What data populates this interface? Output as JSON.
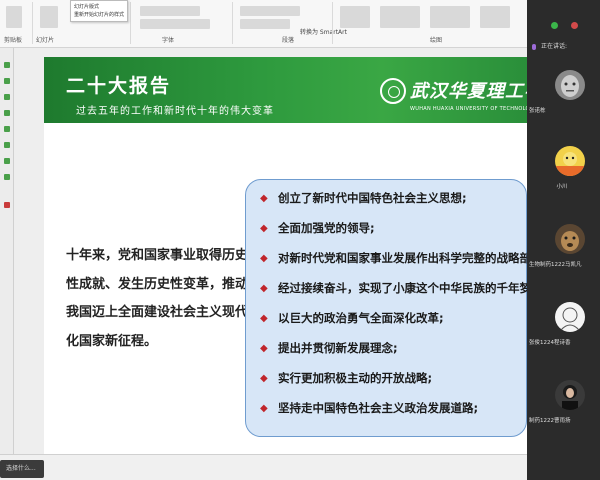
{
  "ribbon": {
    "groups": [
      "剪贴板",
      "幻灯片",
      "字体",
      "段落",
      "绘图"
    ],
    "tooltip_lines": [
      "幻灯片版式",
      "重新开始幻灯片的样式"
    ],
    "right_text": "转换为 SmartArt"
  },
  "slide": {
    "title": "二十大报告",
    "subtitle": "过去五年的工作和新时代十年的伟大变革",
    "logo_cn": "武汉华夏理工学院",
    "logo_en": "WUHAN HUAXIA UNIVERSITY OF TECHNOLOGY",
    "paragraph": "十年来，党和国家事业取得历史性成就、发生历史性变革，推动我国迈上全面建设社会主义现代化国家新征程。",
    "bullet_mark": "◆",
    "bullets": [
      "创立了新时代中国特色社会主义思想;",
      "全面加强党的领导;",
      "对新时代党和国家事业发展作出科学完整的战略部署;",
      "经过接续奋斗，实现了小康这个中华民族的千年梦想;",
      "以巨大的政治勇气全面深化改革;",
      "提出并贯彻新发展理念;",
      "实行更加积极主动的开放战略;",
      "坚持走中国特色社会主义政治发展道路;"
    ]
  },
  "participants": {
    "header": "正在讲话:",
    "list": [
      {
        "name": "张诺栋",
        "avatar": "face-avatar"
      },
      {
        "name": "小川",
        "avatar": "cartoon-avatar"
      },
      {
        "name": "生物制药1222马凯凡",
        "avatar": "animal-avatar"
      },
      {
        "name": "张俊1224程诗香",
        "avatar": "sketch-avatar"
      },
      {
        "name": "制药1222曹雨扬",
        "avatar": "person-avatar"
      }
    ]
  },
  "taskbar": {
    "label": "选择什么..."
  },
  "colors": {
    "header_green": "#2e9a3e",
    "bullet_box": "#d7e6f7",
    "bullet_mark": "#c0262c",
    "panel_bg": "#2b2b2b"
  }
}
